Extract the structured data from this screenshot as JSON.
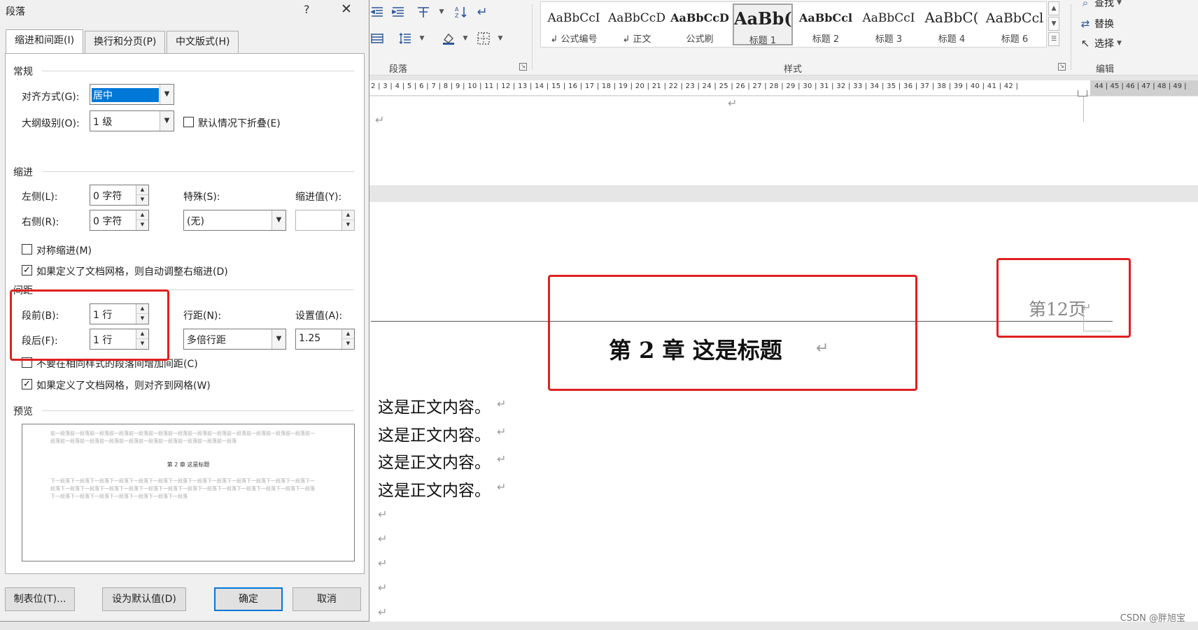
{
  "dialog": {
    "title": "段落",
    "help": "?",
    "close": "✕",
    "tabs": [
      "缩进和间距(I)",
      "换行和分页(P)",
      "中文版式(H)"
    ],
    "general": {
      "section": "常规",
      "align_label": "对齐方式(G):",
      "align_value": "居中",
      "outline_label": "大纲级别(O):",
      "outline_value": "1 级",
      "collapse_label": "默认情况下折叠(E)"
    },
    "indent": {
      "section": "缩进",
      "left_label": "左侧(L):",
      "left_value": "0 字符",
      "right_label": "右侧(R):",
      "right_value": "0 字符",
      "special_label": "特殊(S):",
      "special_value": "(无)",
      "by_label": "缩进值(Y):",
      "by_value": "",
      "mirror_label": "对称缩进(M)",
      "mirror_checked": false,
      "autoadjust_label": "如果定义了文档网格，则自动调整右缩进(D)",
      "autoadjust_checked": true
    },
    "spacing": {
      "section": "间距",
      "before_label": "段前(B):",
      "before_value": "1 行",
      "after_label": "段后(F):",
      "after_value": "1 行",
      "linespacing_label": "行距(N):",
      "linespacing_value": "多倍行距",
      "at_label": "设置值(A):",
      "at_value": "1.25",
      "nospace_label": "不要在相同样式的段落间增加间距(C)",
      "nospace_checked": false,
      "snapgrid_label": "如果定义了文档网格，则对齐到网格(W)",
      "snapgrid_checked": true
    },
    "preview": {
      "section": "预览",
      "prev_text": "前一段落前一段落前一段落前一段落前一段落前一段落前一段落前一段落前一段落前一段落前一段落前一段落前一段落前一段落前一段落前一段落前一段落前一段落前一段落前一段落前一段落前一段落前一段落",
      "title_text": "第 2 章   这是标题",
      "next_text": "下一段落下一段落下一段落下一段落下一段落下一段落下一段落下一段落下一段落下一段落下一段落下一段落下一段落下一段落下一段落下一段落下一段落下一段落下一段落下一段落下一段落下一段落下一段落下一段落下一段落下一段落下一段落下一段落下一段落下一段落下一段落下一段落下一段落下一段落"
    },
    "buttons": {
      "tabs": "制表位(T)...",
      "default": "设为默认值(D)",
      "ok": "确定",
      "cancel": "取消"
    }
  },
  "ribbon": {
    "paragraph_label": "段落",
    "styles_label": "样式",
    "editing_label": "编辑",
    "styles": [
      {
        "preview": "AaBbCcI",
        "name": "↲ 公式编号"
      },
      {
        "preview": "AaBbCcD",
        "name": "↲ 正文"
      },
      {
        "preview": "AaBbCcD",
        "name": "公式刷"
      },
      {
        "preview": "AaBb(",
        "name": "标题 1"
      },
      {
        "preview": "AaBbCcl",
        "name": "标题 2"
      },
      {
        "preview": "AaBbCcI",
        "name": "标题 3"
      },
      {
        "preview": "AaBbC(",
        "name": "标题 4"
      },
      {
        "preview": "AaBbCcl",
        "name": "标题 6"
      }
    ],
    "edit": {
      "find": "查找",
      "replace": "替换",
      "select": "选择"
    }
  },
  "ruler": {
    "numbers": "2 | 3 | 4 | 5 | 6 | 7 | 8 | 9 | 10 | 11 | 12 | 13 | 14 | 15 | 16 | 17 | 18 | 19 | 20 | 21 | 22 | 23 | 24 | 25 | 26 | 27 | 28 | 29 | 30 | 31 | 32 | 33 | 34 | 35 | 36 | 37 | 38 | 39 | 40 | 41 | 42 |",
    "grey_numbers": "44 | 45 | 46 | 47 | 48 | 49 |"
  },
  "document": {
    "page_number": "第12页",
    "chapter_title": "第 2 章    这是标题",
    "body": [
      "这是正文内容。",
      "这是正文内容。",
      "这是正文内容。",
      "这是正文内容。"
    ],
    "para_mark": "↵"
  },
  "watermark": "CSDN @胖旭宝",
  "colors": {
    "accent": "#0078d7",
    "highlight": "#e02020",
    "ribbon_icon": "#2b579a"
  }
}
